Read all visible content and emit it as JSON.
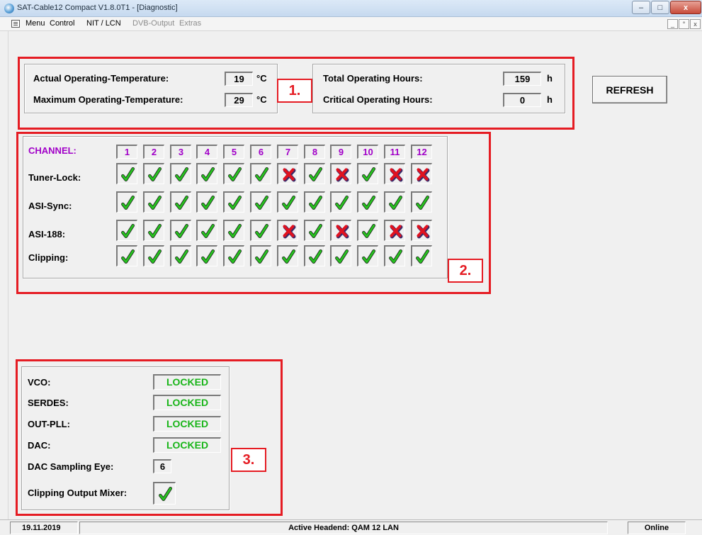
{
  "window": {
    "title": "SAT-Cable12 Compact V1.8.0T1 - [Diagnostic]",
    "min_symbol": "–",
    "max_symbol": "□",
    "close_symbol": "x"
  },
  "menu": {
    "items": [
      {
        "label": "Menu",
        "enabled": true
      },
      {
        "label": "Control",
        "enabled": true
      },
      {
        "label": "NIT / LCN",
        "enabled": true
      },
      {
        "label": "DVB-Output",
        "enabled": false
      },
      {
        "label": "Extras",
        "enabled": false
      }
    ],
    "mdi_min": "_",
    "mdi_restore": "°",
    "mdi_close": "x"
  },
  "temperature": {
    "actual_label": "Actual Operating-Temperature:",
    "actual_value": "19",
    "maximum_label": "Maximum Operating-Temperature:",
    "maximum_value": "29",
    "unit": "°C"
  },
  "hours": {
    "total_label": "Total Operating Hours:",
    "total_value": "159",
    "critical_label": "Critical Operating Hours:",
    "critical_value": "0",
    "unit": "h"
  },
  "refresh_label": "REFRESH",
  "callouts": [
    "1.",
    "2.",
    "3."
  ],
  "channels": {
    "header_label": "CHANNEL:",
    "numbers": [
      "1",
      "2",
      "3",
      "4",
      "5",
      "6",
      "7",
      "8",
      "9",
      "10",
      "11",
      "12"
    ],
    "rows": [
      {
        "label": "Tuner-Lock:",
        "states": [
          true,
          true,
          true,
          true,
          true,
          true,
          false,
          true,
          false,
          true,
          false,
          false
        ]
      },
      {
        "label": "ASI-Sync:",
        "states": [
          true,
          true,
          true,
          true,
          true,
          true,
          true,
          true,
          true,
          true,
          true,
          true
        ]
      },
      {
        "label": "ASI-188:",
        "states": [
          true,
          true,
          true,
          true,
          true,
          true,
          false,
          true,
          false,
          true,
          false,
          false
        ]
      },
      {
        "label": "Clipping:",
        "states": [
          true,
          true,
          true,
          true,
          true,
          true,
          true,
          true,
          true,
          true,
          true,
          true
        ]
      }
    ]
  },
  "pll": {
    "vco_label": "VCO:",
    "vco_value": "LOCKED",
    "serdes_label": "SERDES:",
    "serdes_value": "LOCKED",
    "outpll_label": "OUT-PLL:",
    "outpll_value": "LOCKED",
    "dac_label": "DAC:",
    "dac_value": "LOCKED",
    "eye_label": "DAC Sampling Eye:",
    "eye_value": "6",
    "mixer_label": "Clipping Output Mixer:",
    "mixer_state": true
  },
  "colors": {
    "check": "#27c21f",
    "cross": "#e0121f",
    "channel_text": "#a100c8",
    "locked_text": "#19b519",
    "highlight": "#e51c23"
  },
  "status": {
    "date": "19.11.2019",
    "headend": "Active Headend: QAM 12 LAN",
    "connection": "Online"
  }
}
